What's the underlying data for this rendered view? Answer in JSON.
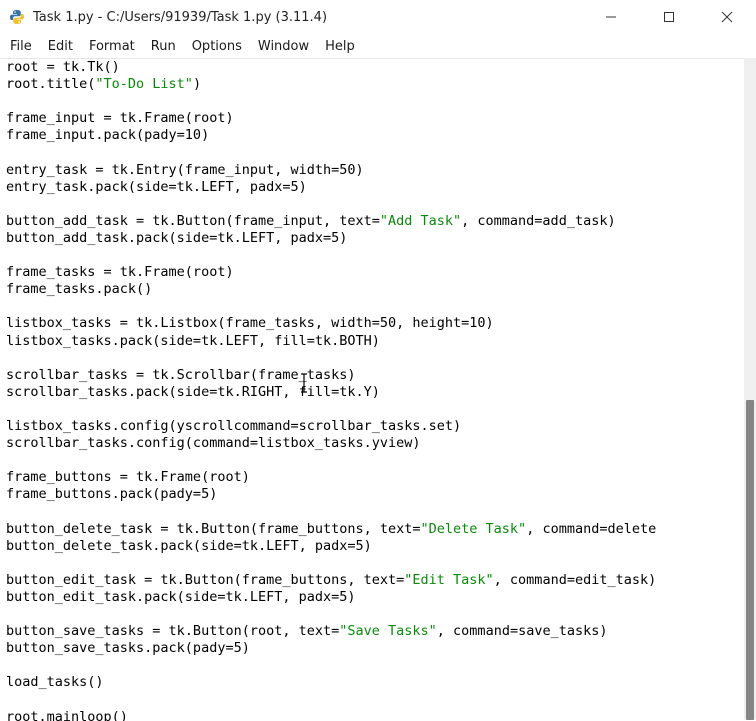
{
  "window": {
    "title": "Task 1.py - C:/Users/91939/Task 1.py (3.11.4)",
    "minimize_icon": "minimize-icon",
    "maximize_icon": "maximize-icon",
    "close_icon": "close-icon"
  },
  "menu": {
    "items": [
      "File",
      "Edit",
      "Format",
      "Run",
      "Options",
      "Window",
      "Help"
    ]
  },
  "editor": {
    "lines": [
      [
        [
          "root = tk.Tk()",
          ""
        ]
      ],
      [
        [
          "root.title(",
          ""
        ],
        [
          "\"To-Do List\"",
          "str"
        ],
        [
          ")",
          ""
        ]
      ],
      [
        [
          "",
          ""
        ]
      ],
      [
        [
          "frame_input = tk.Frame(root)",
          ""
        ]
      ],
      [
        [
          "frame_input.pack(pady=10)",
          ""
        ]
      ],
      [
        [
          "",
          ""
        ]
      ],
      [
        [
          "entry_task = tk.Entry(frame_input, width=50)",
          ""
        ]
      ],
      [
        [
          "entry_task.pack(side=tk.LEFT, padx=5)",
          ""
        ]
      ],
      [
        [
          "",
          ""
        ]
      ],
      [
        [
          "button_add_task = tk.Button(frame_input, text=",
          ""
        ],
        [
          "\"Add Task\"",
          "str"
        ],
        [
          ", command=add_task)",
          ""
        ]
      ],
      [
        [
          "button_add_task.pack(side=tk.LEFT, padx=5)",
          ""
        ]
      ],
      [
        [
          "",
          ""
        ]
      ],
      [
        [
          "frame_tasks = tk.Frame(root)",
          ""
        ]
      ],
      [
        [
          "frame_tasks.pack()",
          ""
        ]
      ],
      [
        [
          "",
          ""
        ]
      ],
      [
        [
          "listbox_tasks = tk.Listbox(frame_tasks, width=50, height=10)",
          ""
        ]
      ],
      [
        [
          "listbox_tasks.pack(side=tk.LEFT, fill=tk.BOTH)",
          ""
        ]
      ],
      [
        [
          "",
          ""
        ]
      ],
      [
        [
          "scrollbar_tasks = tk.Scrollbar(frame_tasks)",
          ""
        ]
      ],
      [
        [
          "scrollbar_tasks.pack(side=tk.RIGHT, fill=tk.Y)",
          ""
        ]
      ],
      [
        [
          "",
          ""
        ]
      ],
      [
        [
          "listbox_tasks.config(yscrollcommand=scrollbar_tasks.set)",
          ""
        ]
      ],
      [
        [
          "scrollbar_tasks.config(command=listbox_tasks.yview)",
          ""
        ]
      ],
      [
        [
          "",
          ""
        ]
      ],
      [
        [
          "frame_buttons = tk.Frame(root)",
          ""
        ]
      ],
      [
        [
          "frame_buttons.pack(pady=5)",
          ""
        ]
      ],
      [
        [
          "",
          ""
        ]
      ],
      [
        [
          "button_delete_task = tk.Button(frame_buttons, text=",
          ""
        ],
        [
          "\"Delete Task\"",
          "str"
        ],
        [
          ", command=delete",
          ""
        ]
      ],
      [
        [
          "button_delete_task.pack(side=tk.LEFT, padx=5)",
          ""
        ]
      ],
      [
        [
          "",
          ""
        ]
      ],
      [
        [
          "button_edit_task = tk.Button(frame_buttons, text=",
          ""
        ],
        [
          "\"Edit Task\"",
          "str"
        ],
        [
          ", command=edit_task)",
          ""
        ]
      ],
      [
        [
          "button_edit_task.pack(side=tk.LEFT, padx=5)",
          ""
        ]
      ],
      [
        [
          "",
          ""
        ]
      ],
      [
        [
          "button_save_tasks = tk.Button(root, text=",
          ""
        ],
        [
          "\"Save Tasks\"",
          "str"
        ],
        [
          ", command=save_tasks)",
          ""
        ]
      ],
      [
        [
          "button_save_tasks.pack(pady=5)",
          ""
        ]
      ],
      [
        [
          "",
          ""
        ]
      ],
      [
        [
          "load_tasks()",
          ""
        ]
      ],
      [
        [
          "",
          ""
        ]
      ],
      [
        [
          "root.mainloop()",
          ""
        ]
      ]
    ]
  },
  "colors": {
    "string": "#0a8a0a",
    "text": "#000000",
    "background": "#ffffff",
    "scroll_thumb": "#858585"
  }
}
